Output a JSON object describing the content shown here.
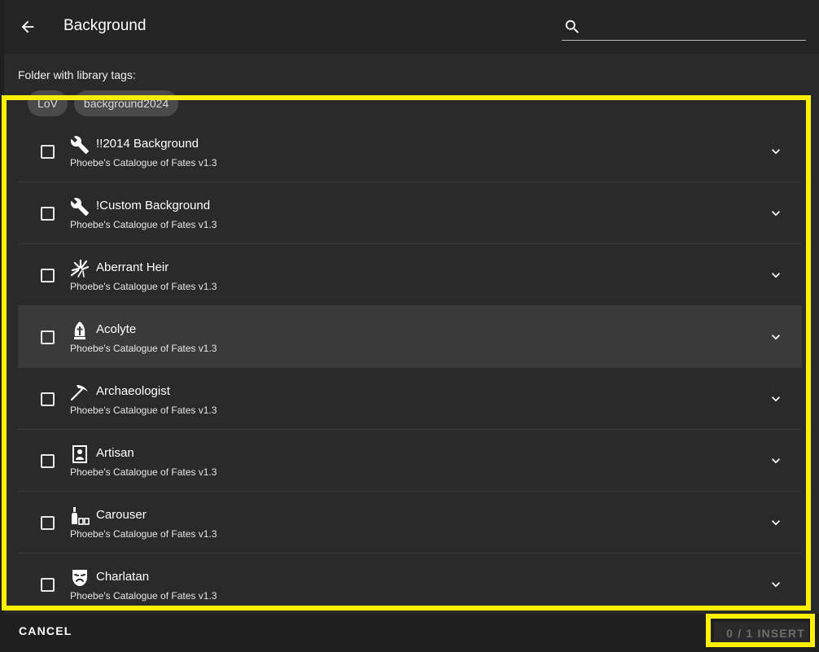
{
  "header": {
    "title": "Background",
    "search": {
      "value": "",
      "placeholder": ""
    }
  },
  "folder": {
    "label": "Folder with library tags:",
    "tags": [
      "LoV",
      "background2024"
    ]
  },
  "items": [
    {
      "title": "!!2014 Background",
      "source": "Phoebe's Catalogue of Fates v1.3",
      "icon": "wrench-icon"
    },
    {
      "title": "!Custom Background",
      "source": "Phoebe's Catalogue of Fates v1.3",
      "icon": "wrench-icon"
    },
    {
      "title": "Aberrant Heir",
      "source": "Phoebe's Catalogue of Fates v1.3",
      "icon": "claw-burst-icon"
    },
    {
      "title": "Acolyte",
      "source": "Phoebe's Catalogue of Fates v1.3",
      "icon": "mitre-icon"
    },
    {
      "title": "Archaeologist",
      "source": "Phoebe's Catalogue of Fates v1.3",
      "icon": "pickaxe-icon"
    },
    {
      "title": "Artisan",
      "source": "Phoebe's Catalogue of Fates v1.3",
      "icon": "portrait-icon"
    },
    {
      "title": "Carouser",
      "source": "Phoebe's Catalogue of Fates v1.3",
      "icon": "bottle-glasses-icon"
    },
    {
      "title": "Charlatan",
      "source": "Phoebe's Catalogue of Fates v1.3",
      "icon": "theater-mask-icon"
    }
  ],
  "footer": {
    "cancel_label": "CANCEL",
    "insert_label": "0 / 1 INSERT"
  },
  "colors": {
    "highlight": "#fff000",
    "background": "#2a2a2a",
    "header": "#242424"
  }
}
